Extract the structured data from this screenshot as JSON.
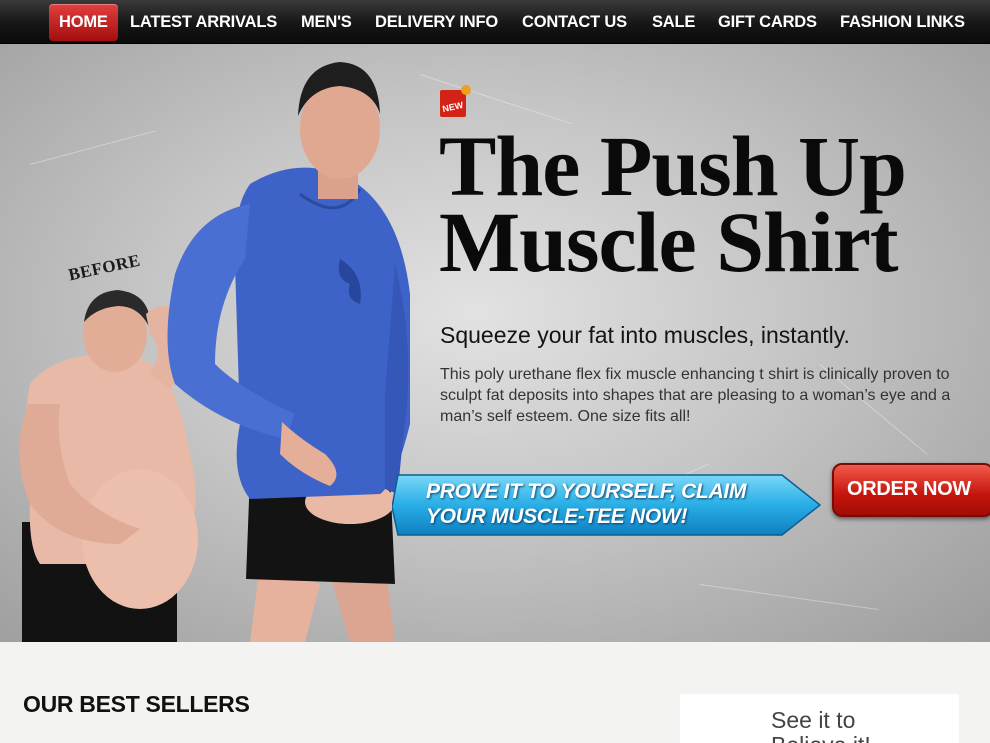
{
  "nav": {
    "items": [
      {
        "label": "HOME",
        "active": true
      },
      {
        "label": "LATEST ARRIVALS"
      },
      {
        "label": "MEN'S"
      },
      {
        "label": "DELIVERY INFO"
      },
      {
        "label": "CONTACT US"
      },
      {
        "label": "SALE"
      },
      {
        "label": "GIFT CARDS"
      },
      {
        "label": "FASHION LINKS"
      }
    ]
  },
  "hero": {
    "badge": "NEW",
    "before_label": "BEFORE",
    "title_line1": "The Push Up",
    "title_line2": "Muscle Shirt",
    "subtitle": "Squeeze your fat into muscles, instantly.",
    "description": "This poly urethane flex fix muscle enhancing t shirt is clinically proven to sculpt fat deposits into shapes that are pleasing to a woman’s eye and a man’s self esteem. One size fits all!",
    "cta_line1": "PROVE IT TO YOURSELF, CLAIM",
    "cta_line2": "YOUR MUSCLE-TEE NOW!",
    "order_button": "ORDER NOW"
  },
  "best_sellers": {
    "heading": "OUR BEST SELLERS"
  },
  "side_box": {
    "line1": "See it to",
    "line2": "Believe it!"
  },
  "colors": {
    "nav_active": "#c41a1a",
    "shirt_blue": "#3e63c8",
    "cta_blue": "#2ab0e6",
    "order_red": "#d21c10"
  }
}
